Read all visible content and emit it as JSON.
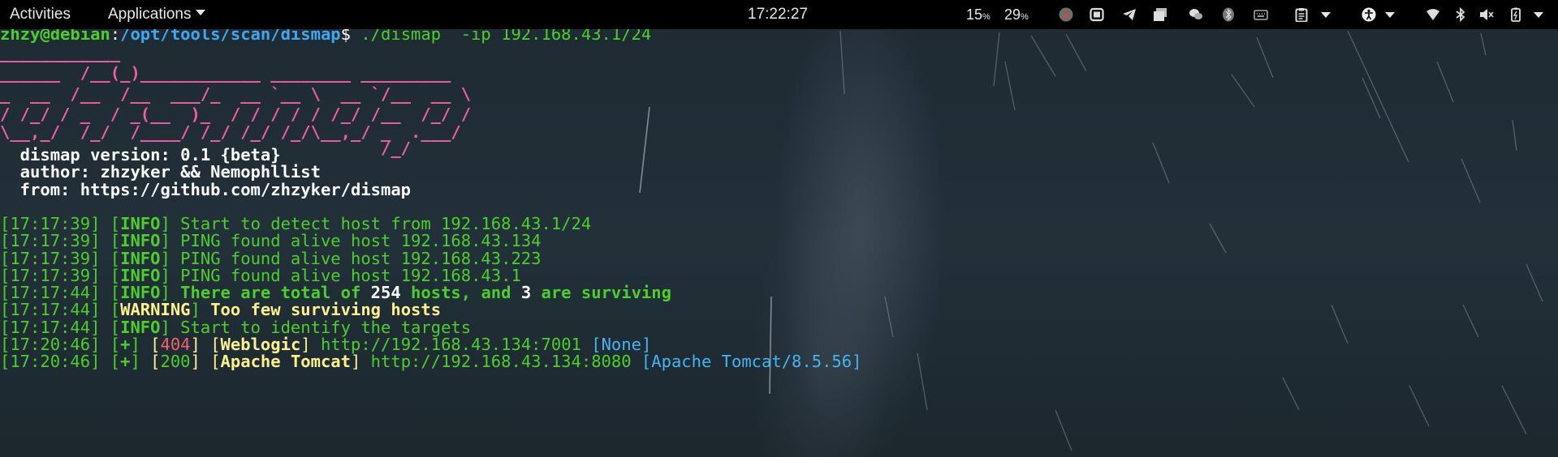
{
  "topbar": {
    "activities": "Activities",
    "applications": "Applications",
    "clock": "17:22:27",
    "cpu_value": "15",
    "mem_value": "29",
    "percent": "%",
    "tray_icons": [
      "app-icon",
      "window-icon",
      "telegram-icon",
      "files-icon",
      "wechat-icon",
      "bluetooth-app-icon",
      "keyboard-icon",
      "clipboard-icon",
      "accessibility-icon",
      "wifi-icon",
      "bluetooth-icon",
      "volume-icon",
      "battery-icon"
    ]
  },
  "terminal": {
    "prompt": {
      "user_host": "zhzy@debian",
      "sep": ":",
      "path": "/opt/tools/scan/dismap",
      "symbol": "$",
      "command": " ./dismap  -ip 192.168.43.1/24"
    },
    "banner": [
      "____________",
      "______  /__(_)____________ ________ _________",
      "_  __  /__  /__  ___/_  __ `__ \\  __ `/__  __ \\",
      "/ /_/ / _  / _(__  )_  / / / / / /_/ /__  /_/ /",
      "\\__,_/  /_/  /____/ /_/ /_/ /_/\\__,_/ _  .___/",
      "                                      /_/"
    ],
    "info": {
      "version": "  dismap version: 0.1 {beta}",
      "author": "  author: zhzyker && Nemophllist",
      "from": "  from: https://github.com/zhzyker/dismap"
    },
    "logs": [
      {
        "time": "[17:17:39]",
        "level": "INFO",
        "msg": " Start to detect host from 192.168.43.1/24"
      },
      {
        "time": "[17:17:39]",
        "level": "INFO",
        "msg": " PING found alive host 192.168.43.134"
      },
      {
        "time": "[17:17:39]",
        "level": "INFO",
        "msg": " PING found alive host 192.168.43.223"
      },
      {
        "time": "[17:17:39]",
        "level": "INFO",
        "msg": " PING found alive host 192.168.43.1"
      },
      {
        "time": "[17:17:44]",
        "level": "INFO",
        "p1": " There are total of ",
        "n1": "254",
        "p2": " hosts, and ",
        "n2": "3",
        "p3": " are surviving"
      },
      {
        "time": "[17:17:44]",
        "level": "WARNING",
        "msg": " Too few surviving hosts"
      },
      {
        "time": "[17:17:44]",
        "level": "INFO",
        "msg": " Start to identify the targets"
      },
      {
        "time": "[17:20:46]",
        "plus": "+",
        "code": "404",
        "name": "Weblogic",
        "url": " http://192.168.43.134:7001 ",
        "detail": "None"
      },
      {
        "time": "[17:20:46]",
        "plus": "+",
        "code": "200",
        "name": "Apache Tomcat",
        "url": " http://192.168.43.134:8080 ",
        "detail": "Apache Tomcat/8.5.56"
      }
    ]
  },
  "colors": {
    "topbar_bg": "#000000",
    "terminal_bg": "#1f2b33",
    "green": "#4ccf2a",
    "blue": "#3da7f0",
    "pink": "#f25ca7",
    "yellow": "#fbf28c",
    "red": "#f1636b",
    "cyan": "#44b4f3"
  }
}
